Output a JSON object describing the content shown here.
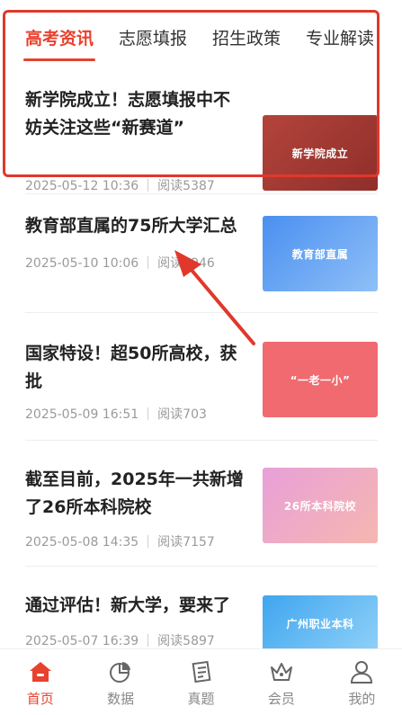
{
  "tabs": [
    {
      "label": "高考资讯",
      "active": true
    },
    {
      "label": "志愿填报",
      "active": false
    },
    {
      "label": "招生政策",
      "active": false
    },
    {
      "label": "专业解读",
      "active": false
    }
  ],
  "articles": [
    {
      "title": "新学院成立！志愿填报中不妨关注这些“新赛道”",
      "date": "2025-05-12 10:36",
      "reads": "阅读5387",
      "thumb_text": "新学院成立"
    },
    {
      "title": "教育部直属的75所大学汇总",
      "date": "2025-05-10 10:06",
      "reads": "阅读1946",
      "thumb_text": "教育部直属"
    },
    {
      "title": "国家特设！超50所高校，获批",
      "date": "2025-05-09 16:51",
      "reads": "阅读703",
      "thumb_text": "“一老一小”"
    },
    {
      "title": "截至目前，2025年一共新增了26所本科院校",
      "date": "2025-05-08 14:35",
      "reads": "阅读7157",
      "thumb_text": "26所本科院校"
    },
    {
      "title": "通过评估！新大学，要来了",
      "date": "2025-05-07 16:39",
      "reads": "阅读5897",
      "thumb_text": "广州职业本科"
    }
  ],
  "bottom_nav": [
    {
      "label": "首页",
      "icon": "home-icon",
      "active": true
    },
    {
      "label": "数据",
      "icon": "chart-icon",
      "active": false
    },
    {
      "label": "真题",
      "icon": "exam-paper-icon",
      "active": false
    },
    {
      "label": "会员",
      "icon": "crown-icon",
      "active": false
    },
    {
      "label": "我的",
      "icon": "user-icon",
      "active": false
    }
  ],
  "colors": {
    "accent": "#e8412e",
    "highlight": "#e0382b"
  }
}
